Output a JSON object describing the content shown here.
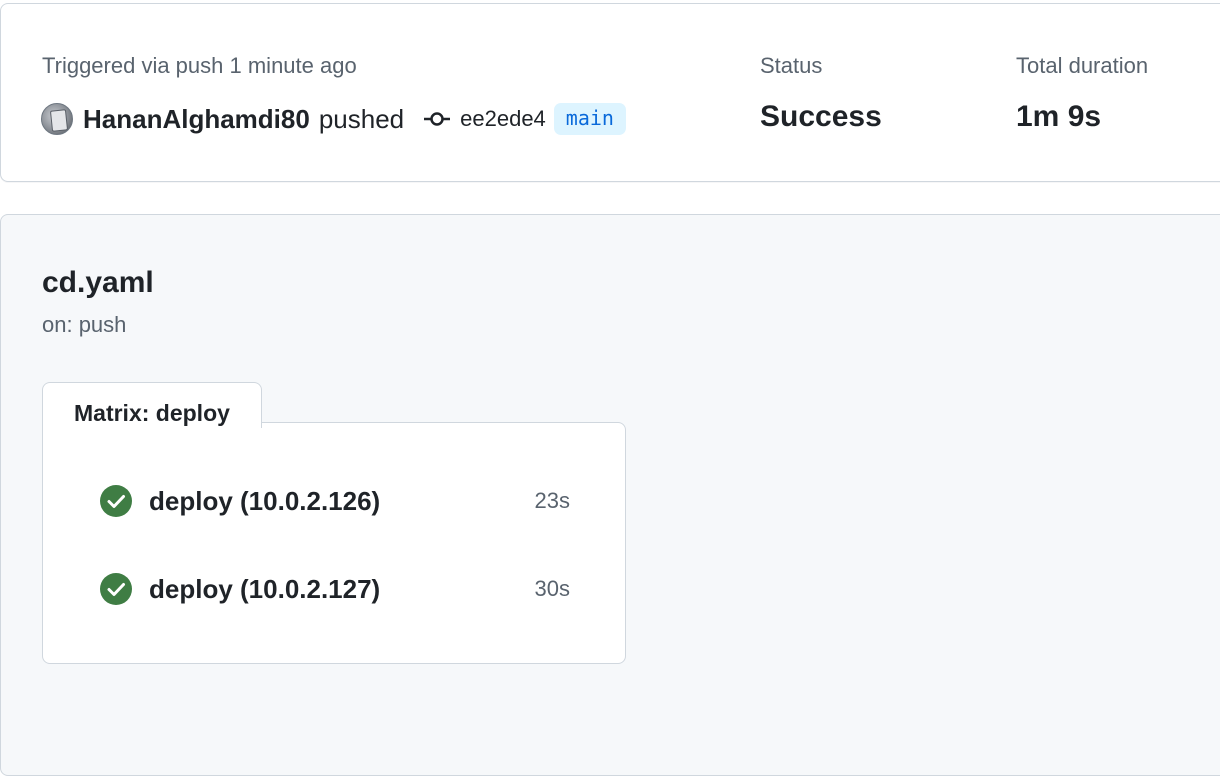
{
  "summary": {
    "trigger_text": "Triggered via push 1 minute ago",
    "actor_name": "HananAlghamdi80",
    "action_word": "pushed",
    "commit_sha": "ee2ede4",
    "branch": "main",
    "status_label": "Status",
    "status_value": "Success",
    "duration_label": "Total duration",
    "duration_value": "1m 9s"
  },
  "workflow": {
    "file_name": "cd.yaml",
    "trigger": "on: push",
    "matrix_title": "Matrix: deploy",
    "jobs": [
      {
        "name": "deploy (10.0.2.126)",
        "duration": "23s",
        "status": "success",
        "icon": "check-circle-fill-icon"
      },
      {
        "name": "deploy (10.0.2.127)",
        "duration": "30s",
        "status": "success",
        "icon": "check-circle-fill-icon"
      }
    ]
  },
  "colors": {
    "success": "#3f7d44",
    "branch_bg": "#ddf4ff",
    "branch_fg": "#0969da",
    "muted_text": "#59636e",
    "panel_bg": "#f6f8fa"
  }
}
